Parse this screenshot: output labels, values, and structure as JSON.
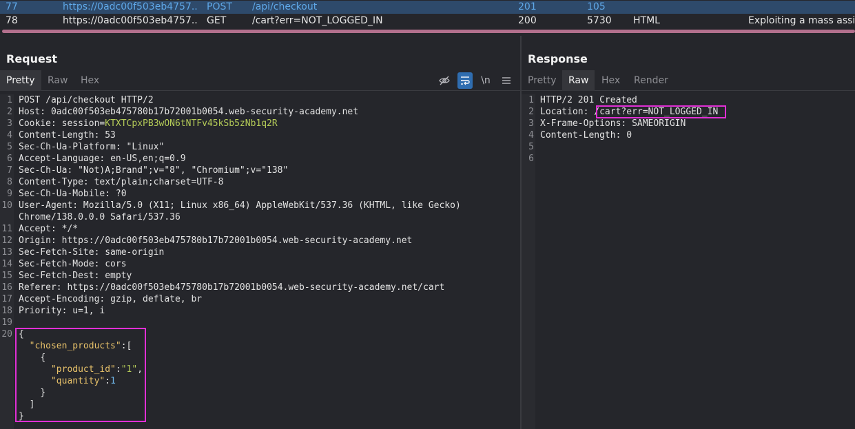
{
  "history": {
    "rows": [
      {
        "id": "77",
        "url": "https://0adc00f503eb4757...",
        "method": "POST",
        "path": "/api/checkout",
        "status": "201",
        "length": "105",
        "mime": "",
        "title": ""
      },
      {
        "id": "78",
        "url": "https://0adc00f503eb4757...",
        "method": "GET",
        "path": "/cart?err=NOT_LOGGED_IN",
        "status": "200",
        "length": "5730",
        "mime": "HTML",
        "title": "Exploiting a mass assi..."
      }
    ]
  },
  "request": {
    "title": "Request",
    "tabs": [
      "Pretty",
      "Raw",
      "Hex"
    ],
    "active_tab": "Pretty",
    "tools": {
      "hide_icon": "eye-off",
      "wrap_icon": "wrap-lines",
      "newline_label": "\\n",
      "menu_icon": "hamburger-menu"
    },
    "line_numbers": [
      "1",
      "2",
      "3",
      "4",
      "5",
      "6",
      "7",
      "8",
      "9",
      "10",
      "",
      "11",
      "12",
      "13",
      "14",
      "15",
      "16",
      "17",
      "18",
      "19",
      "20",
      "",
      "",
      "",
      "",
      "",
      "",
      ""
    ],
    "lines": [
      {
        "key": "POST /api/checkout HTTP/2",
        "value": ""
      },
      {
        "key": "Host: ",
        "value": "0adc00f503eb475780b17b72001b0054.web-security-academy.net"
      },
      {
        "key": "Cookie: ",
        "value": "session=",
        "extra": "KTXTCpxPB3wON6tNTFv45kSb5zNb1q2R"
      },
      {
        "key": "Content-Length: ",
        "value": "53"
      },
      {
        "key": "Sec-Ch-Ua-Platform: ",
        "value": "\"Linux\""
      },
      {
        "key": "Accept-Language: ",
        "value": "en-US,en;q=0.9"
      },
      {
        "key": "Sec-Ch-Ua: ",
        "value": "\"Not)A;Brand\";v=\"8\", \"Chromium\";v=\"138\""
      },
      {
        "key": "Content-Type: ",
        "value": "text/plain;charset=UTF-8"
      },
      {
        "key": "Sec-Ch-Ua-Mobile: ",
        "value": "?0"
      },
      {
        "key": "User-Agent: ",
        "value": "Mozilla/5.0 (X11; Linux x86_64) AppleWebKit/537.36 (KHTML, like Gecko)"
      },
      {
        "key": "Chrome/138.0.0.0 Safari/537.36",
        "value": ""
      },
      {
        "key": "Accept: ",
        "value": "*/*"
      },
      {
        "key": "Origin: ",
        "value": "https://0adc00f503eb475780b17b72001b0054.web-security-academy.net"
      },
      {
        "key": "Sec-Fetch-Site: ",
        "value": "same-origin"
      },
      {
        "key": "Sec-Fetch-Mode: ",
        "value": "cors"
      },
      {
        "key": "Sec-Fetch-Dest: ",
        "value": "empty"
      },
      {
        "key": "Referer: ",
        "value": "https://0adc00f503eb475780b17b72001b0054.web-security-academy.net/cart"
      },
      {
        "key": "Accept-Encoding: ",
        "value": "gzip, deflate, br"
      },
      {
        "key": "Priority: ",
        "value": "u=1, i"
      },
      {
        "key": "",
        "value": ""
      }
    ],
    "body": {
      "open_brace": "{",
      "chosen_products_key": "\"chosen_products\"",
      "colon_bracket": ":[",
      "inner_open": "{",
      "product_id_key": "\"product_id\"",
      "product_id_value": "\"1\"",
      "quantity_key": "\"quantity\"",
      "quantity_value": "1",
      "inner_close": "}",
      "bracket_close": "]",
      "close_brace": "}"
    }
  },
  "response": {
    "title": "Response",
    "tabs": [
      "Pretty",
      "Raw",
      "Hex",
      "Render"
    ],
    "active_tab": "Raw",
    "line_numbers": [
      "1",
      "2",
      "3",
      "4",
      "5",
      "6"
    ],
    "lines": [
      {
        "key": "HTTP/2 201 Created",
        "value": ""
      },
      {
        "key": "Location: ",
        "value": "/cart?err=NOT_LOGGED_IN"
      },
      {
        "key": "X-Frame-Options: ",
        "value": "SAMEORIGIN"
      },
      {
        "key": "Content-Length: ",
        "value": "0"
      },
      {
        "key": "",
        "value": ""
      },
      {
        "key": "",
        "value": ""
      }
    ]
  },
  "colors": {
    "highlight": "#e12fd5",
    "accent": "#2f6db0",
    "selected_row": "#2e4a6b"
  }
}
